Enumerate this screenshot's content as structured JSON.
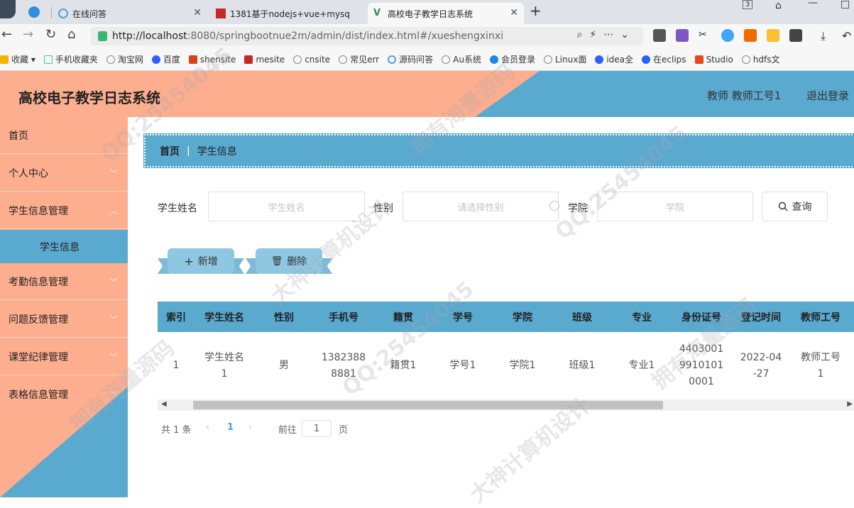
{
  "browser": {
    "tabs": [
      {
        "title": "在线问答"
      },
      {
        "title": "1381基于nodejs+vue+mysq"
      },
      {
        "title": "高校电子教学日志系统"
      }
    ],
    "tab_counter": "3",
    "url_host": "http://localhost",
    "url_rest": ":8080/springbootnue2m/admin/dist/index.html#/xueshengxinxi",
    "bookmarks": [
      "收藏",
      "手机收藏夹",
      "淘宝网",
      "百度",
      "shensite",
      "mesite",
      "cnsite",
      "常见err",
      "源码问答",
      "Au系统",
      "会员登录",
      "Linux面",
      "idea全",
      "在eclips",
      "Studio",
      "hdfs文"
    ]
  },
  "header": {
    "title": "高校电子教学日志系统",
    "user": "教师 教师工号1",
    "logout": "退出登录"
  },
  "sidebar": {
    "items": [
      "首页",
      "个人中心",
      "学生信息管理",
      "学生信息",
      "考勤信息管理",
      "问题反馈管理",
      "课堂纪律管理",
      "表格信息管理"
    ]
  },
  "breadcrumb": {
    "home": "首页",
    "current": "学生信息"
  },
  "search": {
    "name_label": "学生姓名",
    "name_placeholder": "学生姓名",
    "gender_label": "性别",
    "gender_placeholder": "请选择性别",
    "college_label": "学院",
    "college_placeholder": "学院",
    "query_button": "查询"
  },
  "actions": {
    "add": "新增",
    "delete": "删除"
  },
  "table": {
    "columns": [
      "索引",
      "学生姓名",
      "性别",
      "手机号",
      "籍贯",
      "学号",
      "学院",
      "班级",
      "专业",
      "身份证号",
      "登记时间",
      "教师工号"
    ],
    "rows": [
      [
        "1",
        "学生姓名\n1",
        "男",
        "1382388\n8881",
        "籍贯1",
        "学号1",
        "学院1",
        "班级1",
        "专业1",
        "4403001\n9910101\n0001",
        "2022-04\n-27",
        "教师工号\n1"
      ]
    ]
  },
  "pagination": {
    "total": "共 1 条",
    "current_page": "1",
    "goto_label": "前往",
    "goto_value": "1",
    "page_suffix": "页"
  },
  "watermark": {
    "qq": "QQ:25454045",
    "text1": "拥有海量源码",
    "text2": "大神计算机设计"
  },
  "colors": {
    "salmon": "#fcae8e",
    "blue": "#5aa9cf"
  }
}
